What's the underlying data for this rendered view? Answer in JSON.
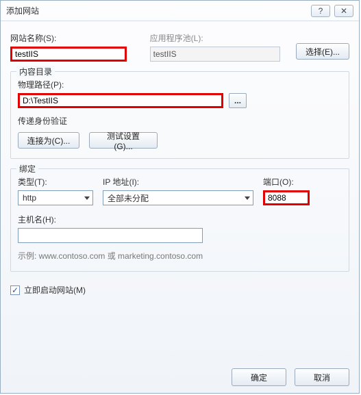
{
  "window": {
    "title": "添加网站",
    "help_glyph": "?",
    "close_glyph": "✕"
  },
  "site": {
    "name_label": "网站名称(S):",
    "name_value": "testIIS",
    "apppool_label": "应用程序池(L):",
    "apppool_value": "testIIS",
    "select_button": "选择(E)..."
  },
  "content": {
    "legend": "内容目录",
    "phys_label": "物理路径(P):",
    "phys_value": "D:\\TestIIS",
    "browse_glyph": "...",
    "auth_label": "传递身份验证",
    "connect_button": "连接为(C)...",
    "test_button": "测试设置(G)..."
  },
  "binding": {
    "legend": "绑定",
    "type_label": "类型(T):",
    "type_value": "http",
    "ip_label": "IP 地址(I):",
    "ip_value": "全部未分配",
    "port_label": "端口(O):",
    "port_value": "8088",
    "host_label": "主机名(H):",
    "host_value": "",
    "example": "示例: www.contoso.com 或 marketing.contoso.com"
  },
  "start": {
    "checked": true,
    "label": "立即启动网站(M)",
    "check_glyph": "✓"
  },
  "footer": {
    "ok": "确定",
    "cancel": "取消"
  }
}
